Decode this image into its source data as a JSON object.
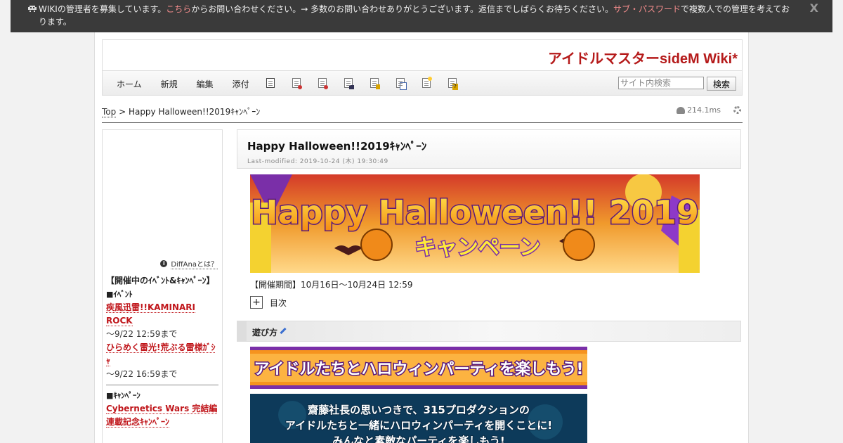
{
  "notice": {
    "part1": "WIKIの管理者を募集しています。",
    "link1": "こちら",
    "part2": "からお問い合わせください。→ 多数のお問い合わせありがとうございます。返信までしばらくお待ちください。",
    "link2": "サブ・パスワード",
    "part3": "で複数人での管理を考えております。",
    "close": "X"
  },
  "site_title": "アイドルマスターsideM Wiki*",
  "menu": [
    "ホーム",
    "新規",
    "編集",
    "添付"
  ],
  "tool_icons": [
    "copy-icon",
    "diff-icon",
    "backup-icon",
    "save-icon",
    "freeze-icon",
    "rename-icon",
    "list-icon",
    "help-icon"
  ],
  "search": {
    "placeholder": "サイト内検索",
    "button": "検索"
  },
  "breadcrumb": {
    "top": "Top",
    "sep": " > ",
    "current": "Happy Halloween!!2019ｷｬﾝﾍﾟｰﾝ"
  },
  "render_time": "214.1ms",
  "sidebar": {
    "diffana_label": "DiffAnaとは？",
    "heading": "【開催中のｲﾍﾞﾝﾄ&ｷｬﾝﾍﾟｰﾝ】",
    "event_head": "■ｲﾍﾞﾝﾄ",
    "event1": "疾風迅雷!!KAMINARI ROCK",
    "event1_until": "～9/22 12:59まで",
    "event2": "ひらめく雷光!荒ぶる雷様ｶﾞｼｬ",
    "event2_until": "～9/22 16:59まで",
    "campaign_head": "■ｷｬﾝﾍﾟｰﾝ",
    "campaign1": "Cybernetics Wars 完結編連載記念ｷｬﾝﾍﾟｰﾝ"
  },
  "page": {
    "title": "Happy Halloween!!2019ｷｬﾝﾍﾟｰﾝ",
    "last_modified": "Last-modified: 2019-10-24 (木) 19:30:49",
    "banner_text": "Happy Halloween!! 2019",
    "banner_sub": "キャンペーン",
    "period": "【開催期間】10月16日～10月24日 12:59",
    "toc_toggle": "+",
    "toc_label": "目次",
    "section_heading": "遊び方",
    "image2_text": "アイドルたちとハロウィンパーティを楽しもう!",
    "image3_line1": "齋藤社長の思いつきで、315プロダクションの",
    "image3_line2": "アイドルたちと一緒にハロウィンパーティを開くことに!",
    "image3_line3": "みんなと素敵なパーティを楽しもう!"
  }
}
